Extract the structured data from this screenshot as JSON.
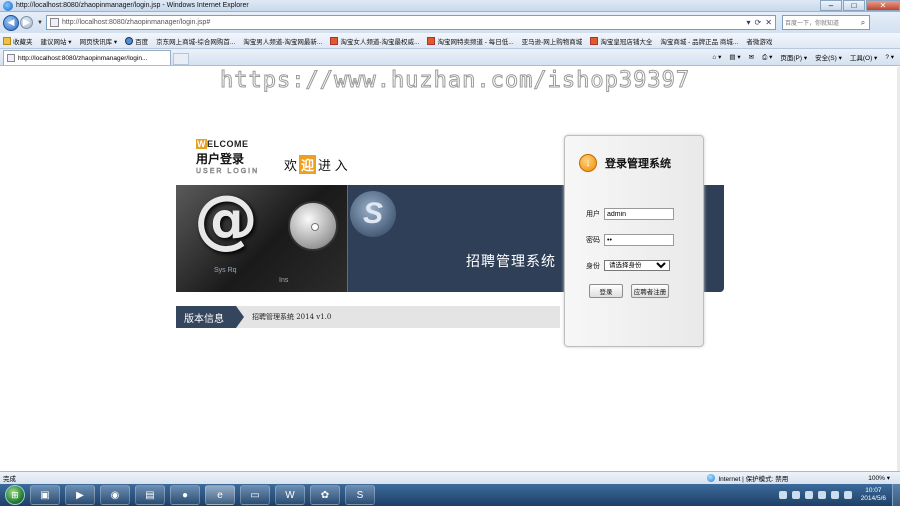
{
  "window": {
    "title": "http://localhost:8080/zhaopinmanager/login.jsp - Windows Internet Explorer",
    "minimize": "–",
    "maximize": "□",
    "close": "✕"
  },
  "address_bar": {
    "url": "http://localhost:8080/zhaopinmanager/login.jsp#",
    "search_placeholder": "百度一下，你就知道"
  },
  "favorites": {
    "label": "收藏夹",
    "items": [
      {
        "label": "建议网站 ▾",
        "icon": "page"
      },
      {
        "label": "网页快讯库 ▾",
        "icon": "page"
      },
      {
        "label": "百度",
        "icon": "blue"
      },
      {
        "label": "京东网上商城-综合网购首...",
        "icon": "page"
      },
      {
        "label": "淘宝男人频道-淘宝网最新...",
        "icon": "page"
      },
      {
        "label": "淘宝女人频道-淘宝最权威...",
        "icon": "red"
      },
      {
        "label": "淘宝网特卖频道 - 每日低...",
        "icon": "red"
      },
      {
        "label": "亚马逊-网上购物商城",
        "icon": "page"
      },
      {
        "label": "淘宝皇冠店铺大全",
        "icon": "red"
      },
      {
        "label": "淘宝商城 - 品牌正品 商城...",
        "icon": "page"
      },
      {
        "label": "者微游戏",
        "icon": "page"
      }
    ]
  },
  "tab": {
    "label": "http://localhost:8080/zhaopinmanager/login..."
  },
  "command_bar": {
    "page": "页面(P) ▾",
    "safety": "安全(S) ▾",
    "tools": "工具(O) ▾",
    "help": "? ▾"
  },
  "watermark": "https://www.huzhan.com/ishop39397",
  "welcome": {
    "letter": "W",
    "english": "ELCOME",
    "chinese": "用户登录",
    "user_login": "USER LOGIN",
    "tag_pre": "欢",
    "tag_hl": "迎",
    "tag_post": "进 入"
  },
  "banner": {
    "logo_letter": "S",
    "keys1": "Sys Rq",
    "keys2": "Ins",
    "system_title": "招聘管理系统"
  },
  "version": {
    "label": "版本信息",
    "text": "招聘管理系统 2014 v1.0"
  },
  "login": {
    "title": "登录管理系统",
    "username_label": "用户",
    "username_value": "admin",
    "password_label": "密码",
    "password_value": "••",
    "identity_label": "身份",
    "identity_selected": "请选择身份",
    "login_button": "登录",
    "register_button": "应聘者注册"
  },
  "statusbar": {
    "left": "完成",
    "zone": "Internet | 保护模式: 禁用",
    "zoom": "100% ▾"
  },
  "taskbar": {
    "time": "10:07",
    "date": "2014/5/6"
  }
}
